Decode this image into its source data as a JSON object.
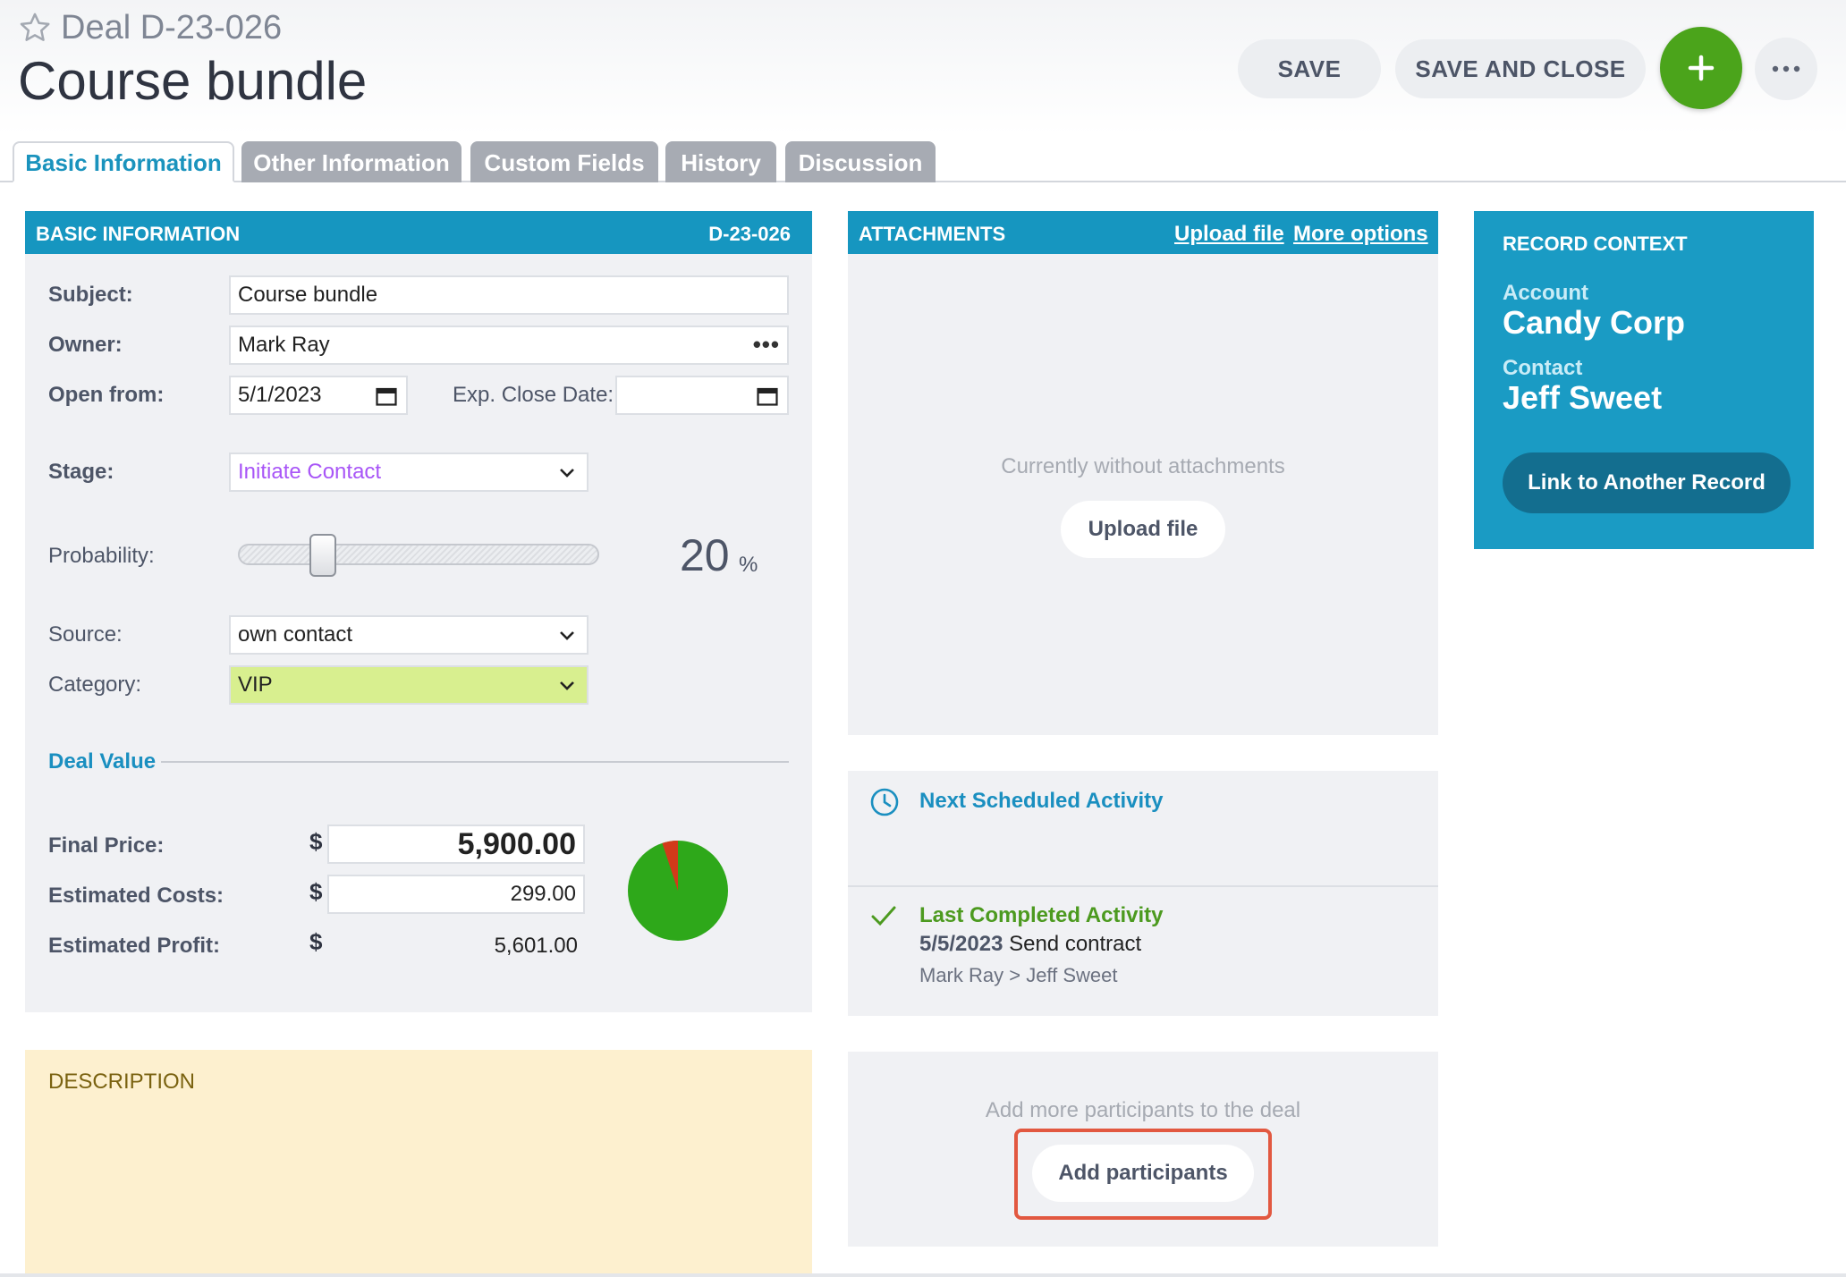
{
  "header": {
    "deal_number": "Deal D-23-026",
    "title": "Course bundle",
    "save_label": "SAVE",
    "save_close_label": "SAVE AND CLOSE",
    "add_symbol": "+",
    "more_symbol": "···"
  },
  "tabs": [
    {
      "label": "Basic Information",
      "active": true
    },
    {
      "label": "Other Information",
      "active": false
    },
    {
      "label": "Custom Fields",
      "active": false
    },
    {
      "label": "History",
      "active": false
    },
    {
      "label": "Discussion",
      "active": false
    }
  ],
  "basic_info": {
    "heading": "BASIC INFORMATION",
    "record_id": "D-23-026",
    "subject_label": "Subject:",
    "subject_value": "Course bundle",
    "owner_label": "Owner:",
    "owner_value": "Mark Ray",
    "owner_more": "•••",
    "open_from_label": "Open from:",
    "open_from_value": "5/1/2023",
    "exp_close_label": "Exp. Close Date:",
    "exp_close_value": "",
    "stage_label": "Stage:",
    "stage_value": "Initiate Contact",
    "stage_color": "#a855f7",
    "probability_label": "Probability:",
    "probability_value": "20",
    "probability_unit": "%",
    "probability_fraction": 0.2,
    "source_label": "Source:",
    "source_value": "own contact",
    "category_label": "Category:",
    "category_value": "VIP",
    "category_color": "#d8ef8f"
  },
  "deal_value": {
    "heading": "Deal Value",
    "currency": "$",
    "final_price_label": "Final Price:",
    "final_price": "5,900.00",
    "estimated_costs_label": "Estimated Costs:",
    "estimated_costs": "299.00",
    "estimated_profit_label": "Estimated Profit:",
    "estimated_profit": "5,601.00",
    "pie": {
      "profit": 5601,
      "costs": 299,
      "profit_color": "#2ea81a",
      "costs_color": "#d23a1a"
    }
  },
  "description": {
    "heading": "DESCRIPTION"
  },
  "attachments": {
    "heading": "ATTACHMENTS",
    "upload_link": "Upload file",
    "more_link": "More options",
    "empty_text": "Currently without attachments",
    "upload_button": "Upload file"
  },
  "activities": {
    "next_heading": "Next Scheduled Activity",
    "last_heading": "Last Completed Activity",
    "last_date": "5/5/2023",
    "last_subject": "Send contract",
    "last_people": "Mark Ray > Jeff Sweet",
    "next_color": "#1a8fc0",
    "last_color": "#4c9a1f"
  },
  "participants": {
    "hint": "Add more participants to the deal",
    "button": "Add participants"
  },
  "record_context": {
    "heading": "RECORD CONTEXT",
    "account_label": "Account",
    "account_value": "Candy Corp",
    "contact_label": "Contact",
    "contact_value": "Jeff Sweet",
    "link_button": "Link to Another Record"
  }
}
